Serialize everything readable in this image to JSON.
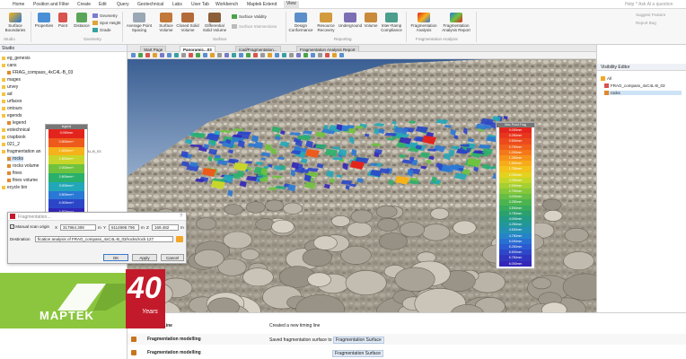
{
  "menu": {
    "items": [
      "Home",
      "Position and Filter",
      "Create",
      "Edit",
      "Query",
      "Geotechnical",
      "Labs",
      "User Tab",
      "Workbench",
      "Maptek Extend",
      "View"
    ],
    "active_index": 10,
    "right_text": "Help  ^ Ask Al a question"
  },
  "ribbon": {
    "studio_label": "Studio",
    "surface_boundaries": "Surface Boundaries",
    "properties": "Properties",
    "point": "Point",
    "distance": "Distance",
    "geometry": "Geometry",
    "spot_height": "Spot Height",
    "grade": "Grade",
    "geometry_group": "Geometry",
    "avg_point_spacing": "Average Point Spacing",
    "surface_volume": "Surface Volume",
    "closed_solid_volume": "Closed Solid Volume",
    "differential_solid_volume": "Differential Solid Volume",
    "surface_validity": "Surface Validity",
    "surface_intersections": "Surface Intersections",
    "surface_group": "Surface",
    "design_conformance": "Design Conformance",
    "resource_recovery": "Resource Recovery",
    "underground": "Underground",
    "volume": "Volume",
    "inter_ramp_compliance": "Inter-Ramp Compliance",
    "reporting_group": "Reporting",
    "fragmentation_analysis": "Fragmentation Analysis",
    "fragmentation_analysis_report": "Fragmentation Analysis Report",
    "fragmentation_group": "Fragmentation Analysis",
    "suggest_feature": "Suggest Feature",
    "report_bug": "Report Bug"
  },
  "left_panel": {
    "header": "Studio",
    "items": [
      {
        "label": "eg_genesis",
        "indent": 0
      },
      {
        "label": "cans",
        "indent": 0
      },
      {
        "label": "FRAG_compass_4xC4L-B_03",
        "indent": 1
      },
      {
        "label": "mages",
        "indent": 0
      },
      {
        "label": "urvey",
        "indent": 0
      },
      {
        "label": "ad",
        "indent": 0
      },
      {
        "label": "urfaces",
        "indent": 0
      },
      {
        "label": "ontours",
        "indent": 0
      },
      {
        "label": "egends",
        "indent": 0
      },
      {
        "label": "legend",
        "indent": 1
      },
      {
        "label": "eotechnical",
        "indent": 0
      },
      {
        "label": "crapbook",
        "indent": 0
      },
      {
        "label": "021_2",
        "indent": 0
      },
      {
        "label": "fragmentation an",
        "indent": 0
      },
      {
        "label": "rocks",
        "indent": 1
      },
      {
        "label": "rocks volume",
        "indent": 1
      },
      {
        "label": "fines",
        "indent": 1
      },
      {
        "label": "fines volume",
        "indent": 1
      },
      {
        "label": "ecycle bin",
        "indent": 0
      }
    ],
    "selected_index": 14,
    "row_note": "compass_4xC4L-B_03"
  },
  "tabs": [
    {
      "label": "Start Page"
    },
    {
      "label": "Panoramic...03"
    },
    {
      "label": "/cad/Fragmentation..."
    },
    {
      "label": "Fragmentation Analysis Report"
    }
  ],
  "active_tab": 1,
  "legend_small": {
    "title": "legend",
    "labels": [
      "0.000mm",
      "0.500mm+",
      "1.000mm+",
      "1.500mm+",
      "2.000mm+",
      "2.500mm+",
      "3.000mm+",
      "3.500mm+",
      "4.000mm+",
      "4.500mm+"
    ],
    "colors": [
      "#e3241d",
      "#ee5a1c",
      "#f6b21a",
      "#c8d62b",
      "#6fc23e",
      "#2ab06a",
      "#22a7b8",
      "#2a78d5",
      "#2b47c8",
      "#3326b8"
    ]
  },
  "legend_large": {
    "title": "Max Point Frag",
    "labels": [
      "0.000mm",
      "0.250mm",
      "0.500mm",
      "0.750mm",
      "1.000mm",
      "1.250mm",
      "1.500mm",
      "1.750mm",
      "2.000mm",
      "2.250mm",
      "2.500mm",
      "2.750mm",
      "3.000mm",
      "3.250mm",
      "3.500mm",
      "3.750mm",
      "4.000mm",
      "4.250mm",
      "4.500mm",
      "4.750mm",
      "5.000mm",
      "5.250mm",
      "5.500mm",
      "5.750mm",
      "6.000mm"
    ],
    "colors": [
      "#e3241d",
      "#e8361d",
      "#ec4a1c",
      "#f05f1b",
      "#f4781a",
      "#f6921a",
      "#f7ab1a",
      "#f3c21b",
      "#e3d21f",
      "#c6d629",
      "#a6cf32",
      "#86c73a",
      "#67be43",
      "#4cb44f",
      "#38aa5e",
      "#2aa06f",
      "#239a84",
      "#229799",
      "#2390b2",
      "#2584c8",
      "#286fd2",
      "#2b5bd0",
      "#2e47c8",
      "#3035bf",
      "#3326b8"
    ]
  },
  "right_panel": {
    "header": "Visibility Editor",
    "items": [
      {
        "label": "All"
      },
      {
        "label": "FRAG_compass_4xC4L-B_03"
      },
      {
        "label": "rocks"
      }
    ]
  },
  "log": [
    {
      "name": "Timing Line",
      "desc": "Created a new timing line"
    },
    {
      "name": "Fragmentation modelling",
      "desc": "Saved fragmentation surface to",
      "chip": "Fragmentation Surface"
    },
    {
      "name": "Fragmentation modelling",
      "desc": "",
      "chip": "Fragmentation Surface"
    }
  ],
  "dialog": {
    "title": "Fragmentation...",
    "manual_scan_origin": "Manual scan origin",
    "x_label": "X",
    "x_value": "317864.308",
    "y_label": "Y",
    "y_value": "6114998.796",
    "z_label": "Z",
    "z_value": "169.482",
    "unit": "m",
    "destination_label": "Destination",
    "destination_value": "fication analysis of FRAG_compass_4xC4L-B_03/rocks/rock 127",
    "ok": "OK",
    "apply": "Apply",
    "cancel": "Cancel"
  },
  "logo": {
    "brand": "MAPTEK",
    "anniversary_number": "40",
    "anniversary_word": "Years",
    "brand_color": "#8cc63f",
    "accent_color": "#c31a2b"
  }
}
